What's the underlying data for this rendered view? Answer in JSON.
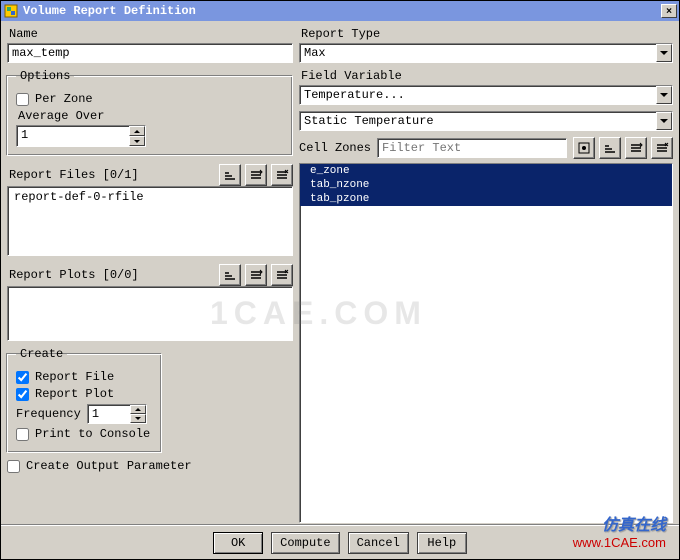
{
  "window": {
    "title": "Volume Report Definition",
    "close": "×"
  },
  "left": {
    "name_label": "Name",
    "name_value": "max_temp",
    "options_legend": "Options",
    "per_zone_label": "Per Zone",
    "average_over_label": "Average Over",
    "average_over_value": "1",
    "report_files_label": "Report Files [0/1]",
    "report_files_items": [
      "report-def-0-rfile"
    ],
    "report_plots_label": "Report Plots [0/0]",
    "create_legend": "Create",
    "report_file_label": "Report File",
    "report_plot_label": "Report Plot",
    "frequency_label": "Frequency",
    "frequency_value": "1",
    "print_console_label": "Print to Console",
    "create_output_label": "Create Output Parameter"
  },
  "right": {
    "report_type_label": "Report Type",
    "report_type_value": "Max",
    "field_variable_label": "Field Variable",
    "field_variable_value": "Temperature...",
    "field_subvalue": "Static Temperature",
    "cell_zones_label": "Cell Zones",
    "cell_zones_placeholder": "Filter Text",
    "zones": [
      "e_zone",
      "tab_nzone",
      "tab_pzone"
    ]
  },
  "buttons": {
    "ok": "OK",
    "compute": "Compute",
    "cancel": "Cancel",
    "help": "Help"
  },
  "watermark": {
    "line1": "仿真在线",
    "line2": "www.1CAE.com"
  },
  "ghost": "1CAE.COM"
}
